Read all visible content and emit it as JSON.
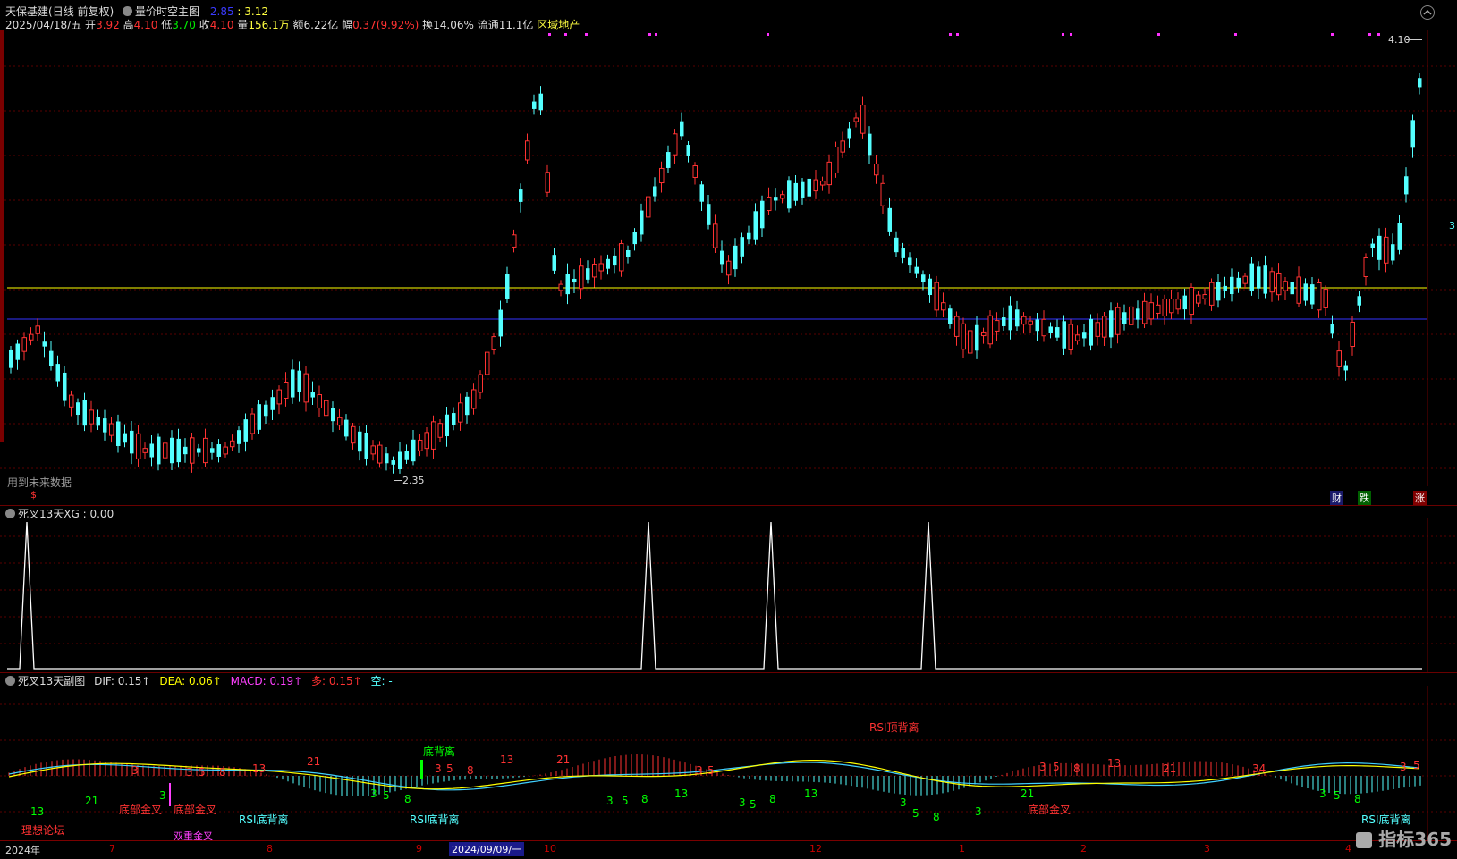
{
  "main": {
    "stock": "天保基建",
    "mode": "(日线 前复权)",
    "indicator": "量价时空主图",
    "ind_v1": "2.85",
    "ind_v2": ": 3.12",
    "date": "2025/04/18/五",
    "open_label": "开",
    "open": "3.92",
    "high_label": "高",
    "high": "4.10",
    "low_label": "低",
    "low": "3.70",
    "close_label": "收",
    "close": "4.10",
    "vol_label": "量",
    "vol": "156.1万",
    "amt": "额6.22亿",
    "chg_label": "幅",
    "chg": "0.37(9.92%)",
    "turn": "换14.06%",
    "float": "流通11.1亿",
    "sector": "区域地产",
    "high_mark": "4.10",
    "low_mark": "2.35",
    "future_note": "用到未来数据",
    "right_mark": "3",
    "bottom_tags": [
      "财",
      "跌",
      "涨"
    ],
    "dollar": "$",
    "yellow_line": 3.12,
    "blue_line": 2.85
  },
  "panel2": {
    "title": "死叉13天XG",
    "value": ": 0.00",
    "peaks": [
      30,
      725,
      862,
      1038
    ]
  },
  "panel3": {
    "title": "死叉13天副图",
    "dif": "DIF: 0.15↑",
    "dea": "DEA: 0.06↑",
    "macd": "MACD: 0.19↑",
    "duo": "多: 0.15↑",
    "kong": "空: -",
    "labels": {
      "rsi_top": "RSI顶背离",
      "bottom_div": "底背离",
      "gold1": "底部金叉",
      "gold2": "底部金叉",
      "gold3": "底部金叉",
      "rsi_b1": "RSI底背离",
      "rsi_b2": "RSI底背离",
      "rsi_b3": "RSI底背离",
      "forum": "理想论坛",
      "double": "双重金叉"
    }
  },
  "xaxis": {
    "labels": [
      "2024年",
      "7",
      "8",
      "9",
      "10",
      "12",
      "1",
      "2",
      "3",
      "4"
    ],
    "highlight": "2024/09/09/一",
    "brand": "指标365"
  },
  "colors": {
    "up": "#ff3232",
    "down": "#54ffff",
    "yellow": "#ffff00",
    "blue": "#3333ff"
  }
}
